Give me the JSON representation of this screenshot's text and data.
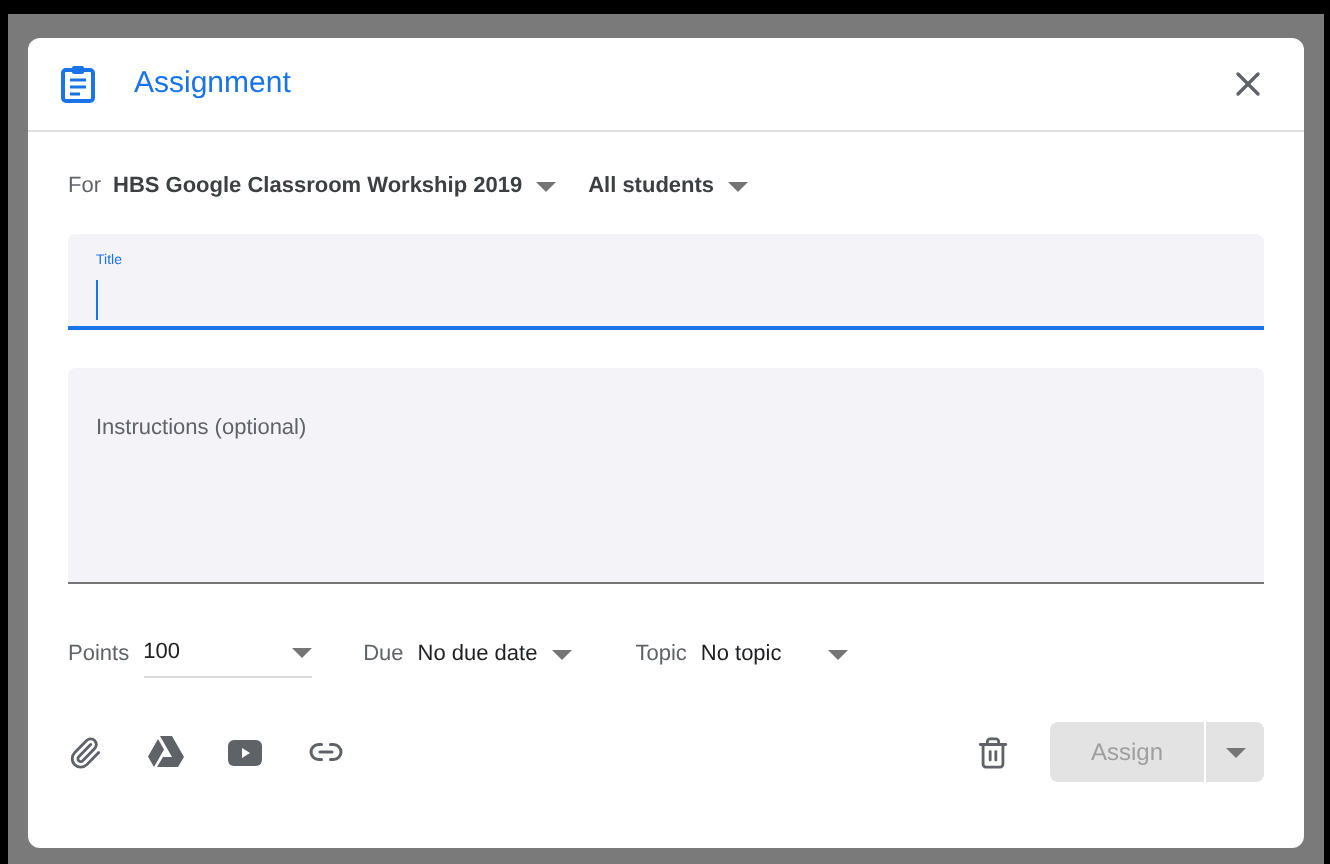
{
  "dialog": {
    "title": "Assignment"
  },
  "for": {
    "label": "For",
    "course": "HBS Google Classroom Workship 2019",
    "audience": "All students"
  },
  "title_field": {
    "label": "Title",
    "focused": true
  },
  "instructions_field": {
    "placeholder": "Instructions (optional)"
  },
  "settings": [
    {
      "kind": "points",
      "label": "Points",
      "value": "100"
    },
    {
      "kind": "due",
      "label": "Due",
      "value": "No due date"
    },
    {
      "kind": "topic",
      "label": "Topic",
      "value": "No topic"
    }
  ],
  "assign_button": {
    "label": "Assign",
    "disabled": true
  }
}
